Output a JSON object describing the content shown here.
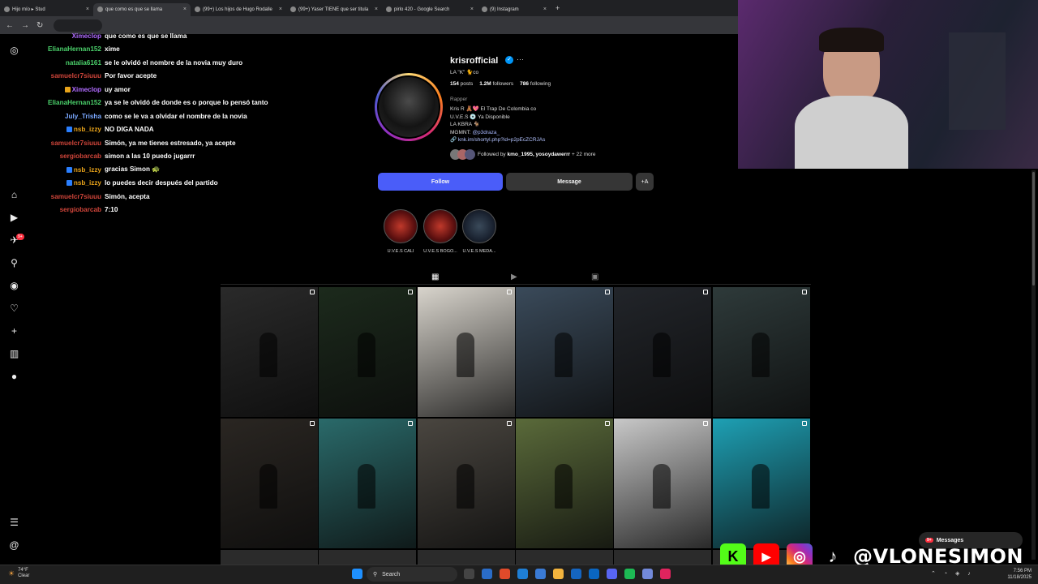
{
  "browser": {
    "tabs": [
      {
        "label": "Hijo mío ▸ Stud",
        "active": false
      },
      {
        "label": "que como es que se llama",
        "active": true
      },
      {
        "label": "(99+) Los hijos de Hugo Rodalle",
        "active": false
      },
      {
        "label": "(99+) Yaser TIENE que ser titula",
        "active": false
      },
      {
        "label": "pirlo 420 - Google Search",
        "active": false
      },
      {
        "label": "(9) Instagram",
        "active": false
      }
    ],
    "tab_close": "×",
    "new_tab": "+"
  },
  "chat": {
    "header_user": "Ximeclop",
    "header_emotes": "😂😂😂",
    "messages": [
      {
        "user": "Ximeclop",
        "text": "que como es que se llama",
        "color": "#b06cff",
        "badge": ""
      },
      {
        "user": "ElianaHernan152",
        "text": "xime",
        "color": "#4bd16b",
        "badge": ""
      },
      {
        "user": "natalia6161",
        "text": "se le olvidó el nombre de la novia muy duro",
        "color": "#4bd16b",
        "badge": ""
      },
      {
        "user": "samuelcr7siuuu",
        "text": "Por favor acepte",
        "color": "#d0453a",
        "badge": ""
      },
      {
        "user": "Ximeclop",
        "text": "uy amor",
        "color": "#b06cff",
        "badge": "gold"
      },
      {
        "user": "ElianaHernan152",
        "text": "ya se le olvidó de donde es o porque lo pensó tanto",
        "color": "#4bd16b",
        "badge": ""
      },
      {
        "user": "July_Trisha",
        "text": "como se le va a olvidar el nombre de la novia",
        "color": "#7aa8ff",
        "badge": ""
      },
      {
        "user": "nsb_izzy",
        "text": "NO DIGA NADA",
        "color": "#e8a31a",
        "badge": "blue"
      },
      {
        "user": "samuelcr7siuuu",
        "text": "Simón, ya me tienes estresado, ya acepte",
        "color": "#d0453a",
        "badge": ""
      },
      {
        "user": "sergiobarcab",
        "text": "simon a las 10 puedo jugarrr",
        "color": "#d0453a",
        "badge": ""
      },
      {
        "user": "nsb_izzy",
        "text": "gracias Simon 🐢",
        "color": "#e8a31a",
        "badge": "blue"
      },
      {
        "user": "nsb_izzy",
        "text": "lo puedes decir después del partido",
        "color": "#e8a31a",
        "badge": "blue"
      },
      {
        "user": "samuelcr7siuuu",
        "text": "Simón, acepta",
        "color": "#d0453a",
        "badge": ""
      },
      {
        "user": "sergiobarcab",
        "text": "7:10",
        "color": "#d0453a",
        "badge": ""
      }
    ]
  },
  "nav": {
    "icons": [
      "instagram-icon",
      "home-icon",
      "reels-icon",
      "messages-icon",
      "search-icon",
      "explore-icon",
      "notifications-icon",
      "create-icon",
      "dashboard-icon",
      "profile-icon",
      "menu-icon",
      "threads-icon"
    ],
    "notif_count": "9+"
  },
  "profile": {
    "username": "krisrofficial",
    "more": "···",
    "fullname": "LA \"K\" 🐈co",
    "posts": "154",
    "posts_label": "posts",
    "followers": "1.2M",
    "followers_label": "followers",
    "following": "786",
    "following_label": "following",
    "category": "Rapper",
    "bio": [
      "Kris R 🧸💖 El Trap De Colombia co",
      "U.V.E.S 💿 Ya Disponible",
      "LA KBRA 🐐",
      "MGMNT: "
    ],
    "mgmnt_handle": "@p3draza_",
    "link": "🔗 knk.im/shortyl.php?id=p2pEcZCRJAs",
    "followed_by_prefix": "Followed by ",
    "followed_by_names": "kmo_1995, yosoydawerrr",
    "followed_by_more": " + 22 more",
    "follow_label": "Follow",
    "message_label": "Message",
    "add_label": "+A"
  },
  "highlights": [
    {
      "label": "U.V.E.S CALI"
    },
    {
      "label": "U.V.E.S BOGO..."
    },
    {
      "label": "U.V.E.S MEDA..."
    }
  ],
  "grid_tabs": [
    "posts-grid-icon",
    "reels-tab-icon",
    "tagged-tab-icon"
  ],
  "grid_tab_glyphs": [
    "▦",
    "▶",
    "▣"
  ],
  "posts": [
    {
      "bg": "#2a2a2a"
    },
    {
      "bg": "#1c2a1c"
    },
    {
      "bg": "#d8d4cc"
    },
    {
      "bg": "#3a4a5a"
    },
    {
      "bg": "#22252a"
    },
    {
      "bg": "#2e3a3a"
    },
    {
      "bg": "#2a2622"
    },
    {
      "bg": "#2a6a6a"
    },
    {
      "bg": "#4a4640"
    },
    {
      "bg": "#5a6a3a"
    },
    {
      "bg": "#c8c8c8"
    },
    {
      "bg": "#1ea0b4"
    }
  ],
  "stream": {
    "handle": "@VLONESIMON",
    "kick": "K"
  },
  "ig_messages": {
    "label": "Messages",
    "badge": "9+"
  },
  "taskbar": {
    "temp": "74°F",
    "weather": "Clear",
    "search": "Search",
    "time": "7:56 PM",
    "date": "11/18/2025"
  }
}
